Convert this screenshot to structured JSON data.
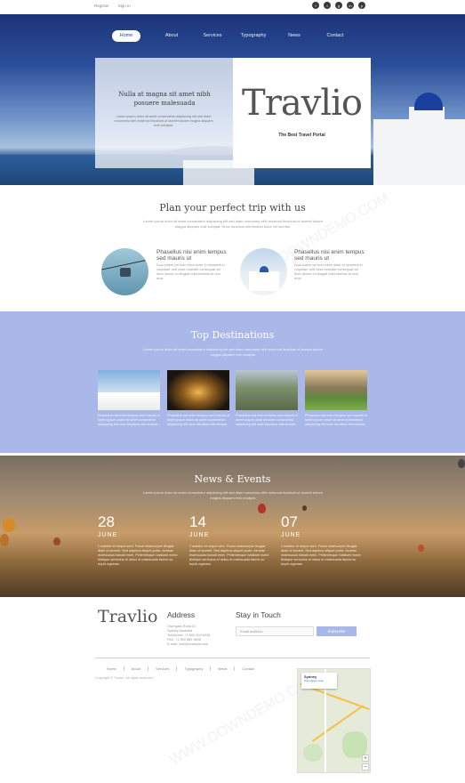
{
  "topbar": {
    "links": [
      "Register",
      "Sign In"
    ],
    "social": [
      "f",
      "t",
      "g",
      "in",
      "p"
    ]
  },
  "nav": {
    "items": [
      "Home",
      "About",
      "Services",
      "Typography",
      "News",
      "Contact"
    ]
  },
  "hero": {
    "slide_title": "Nulla at magna sit amet nibh posuere malesuada",
    "slide_body": "Lorem ipsum dolor sit amet consectetur adipiscing elit sed diam nonummy nibh euismod tincidunt ut laoreet dolore magna aliquam erat volutpat.",
    "logo": "Travlio",
    "tagline": "The Best Travel Portal"
  },
  "plan": {
    "title": "Plan your perfect trip with us",
    "lead": "Lorem ipsum dolor sit amet consectetur adipiscing elit sed diam nonummy nibh euismod tincidunt ut laoreet dolore magna aliquam erat volutpat. Nunc faucibus elementum dolor vel lobortis.",
    "features": [
      {
        "title": "Phasellus nisi enim tempus sed mauris ut",
        "body": "Duis autem vel eum iriure dolor in hendrerit in vulputate velit esse molestie consequat vel illum dolore eu feugiat nulla facilisis at vero eros."
      },
      {
        "title": "Phasellus nisi enim tempus sed mauris ut",
        "body": "Duis autem vel eum iriure dolor in hendrerit in vulputate velit esse molestie consequat vel illum dolore eu feugiat nulla facilisis at vero eros."
      }
    ]
  },
  "destinations": {
    "title": "Top Destinations",
    "lead": "Lorem ipsum dolor sit amet consectetur adipiscing elit sed diam nonummy nibh euismod tincidunt ut laoreet dolore magna aliquam erat volutpat.",
    "captions": [
      "Phasellus nisi enim tempus sed mauris ut lorem ipsum dolor sit amet consectetur adipiscing elit nunc faucibus elementum.",
      "Phasellus nisi enim tempus sed mauris ut lorem ipsum dolor sit amet consectetur adipiscing elit nunc faucibus elementum.",
      "Phasellus nisi enim tempus sed mauris ut lorem ipsum dolor sit amet consectetur adipiscing elit nunc faucibus elementum.",
      "Phasellus nisi enim tempus sed mauris ut lorem ipsum dolor sit amet consectetur adipiscing elit nunc faucibus elementum."
    ]
  },
  "news": {
    "title": "News & Events",
    "lead": "Lorem ipsum dolor sit amet consectetur adipiscing elit sed diam nonummy nibh euismod tincidunt ut laoreet dolore magna aliquam erat volutpat.",
    "events": [
      {
        "day": "28",
        "month": "JUNE",
        "text": "Curabitur et neque sem. Fusce ullamcorper feugiat diam ut laoreet. Sed dapibus aliquet porta. Aenean malesuada blandit enim. Pellentesque habitant morbi tristique senectus et netus et malesuada fames ac turpis egestas."
      },
      {
        "day": "14",
        "month": "JUNE",
        "text": "Curabitur et neque sem. Fusce ullamcorper feugiat diam ut laoreet. Sed dapibus aliquet porta. Aenean malesuada blandit enim. Pellentesque habitant morbi tristique senectus et netus et malesuada fames ac turpis egestas."
      },
      {
        "day": "07",
        "month": "JUNE",
        "text": "Curabitur et neque sem. Fusce ullamcorper feugiat diam ut laoreet. Sed dapibus aliquet porta. Aenean malesuada blandit enim. Pellentesque habitant morbi tristique senectus et netus et malesuada fames ac turpis egestas."
      }
    ]
  },
  "footer": {
    "logo": "Travlio",
    "address_title": "Address",
    "address_lines": [
      "Ostergata Road 31",
      "Sydney Australia",
      "Telephone: +1 800 603 6035",
      "FAX: +1 800 889 9898",
      "E-mail: mail@example.com"
    ],
    "touch_title": "Stay in Touch",
    "email_placeholder": "Email address",
    "subscribe_label": "Subscribe",
    "links": [
      "Home",
      "About",
      "Services",
      "Typography",
      "News",
      "Contact"
    ],
    "copyright": "Copyright © Travlio. All rights reserved.",
    "map": {
      "place": "Sydney",
      "link": "View larger map",
      "zoom_in": "+",
      "zoom_out": "−"
    }
  },
  "watermark": "WWW.DOWNDEMO.COM"
}
